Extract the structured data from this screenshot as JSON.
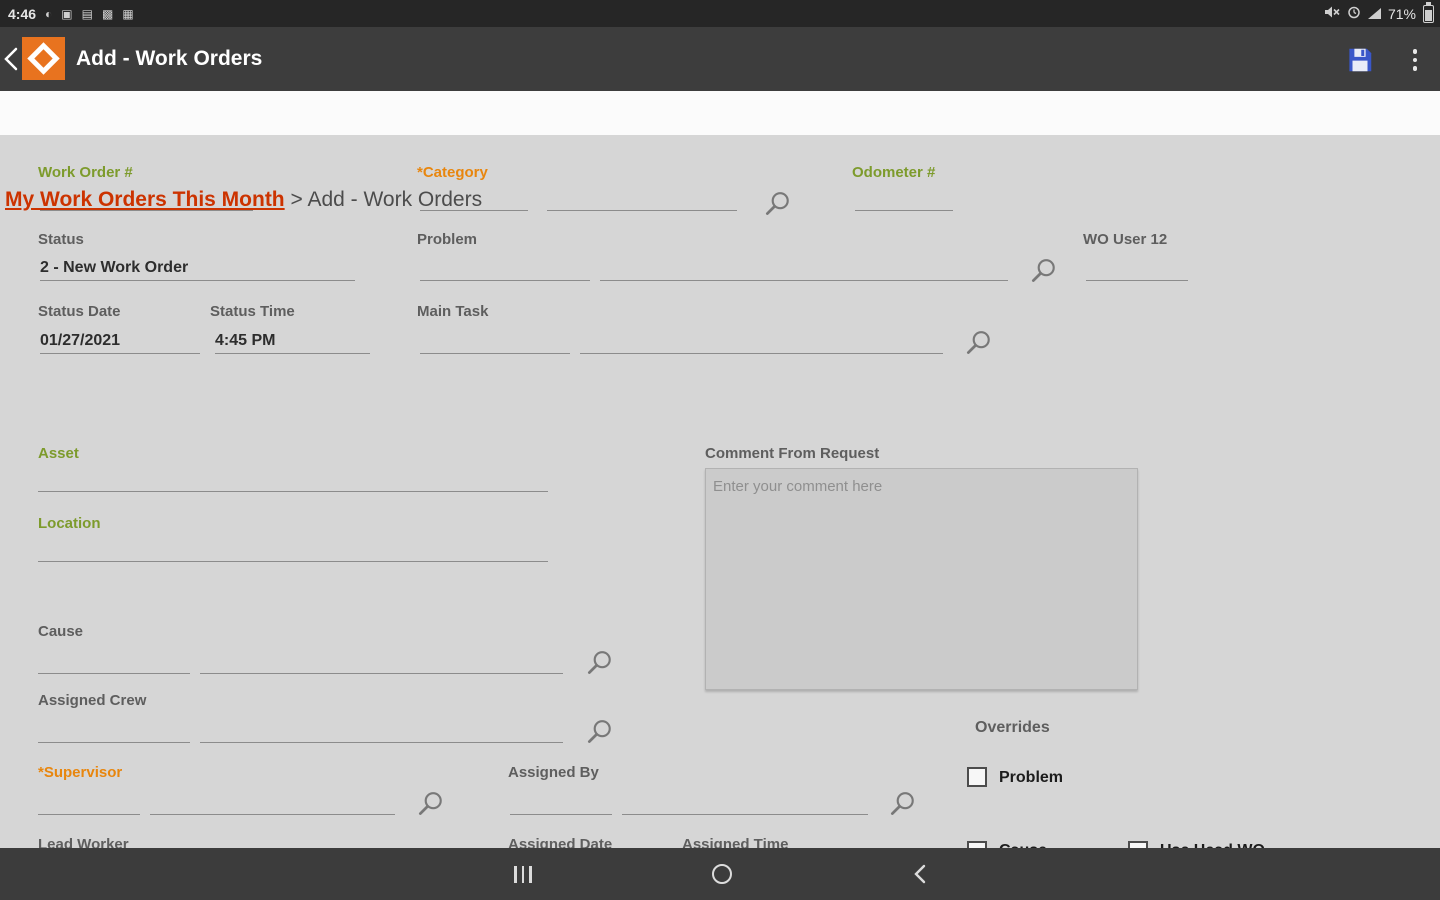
{
  "status_bar": {
    "time": "4:46",
    "battery_percent": "71%"
  },
  "app_bar": {
    "title": "Add - Work Orders"
  },
  "breadcrumb": {
    "link": "My Work Orders This Month",
    "separator": ">",
    "current": "Add - Work Orders"
  },
  "form": {
    "work_order_label": "Work Order #",
    "category_label": "*Category",
    "odometer_label": "Odometer #",
    "status_label": "Status",
    "status_value": "2 - New Work Order",
    "problem_label": "Problem",
    "wo_user_label": "WO User 12",
    "status_date_label": "Status Date",
    "status_date_value": "01/27/2021",
    "status_time_label": "Status Time",
    "status_time_value": "4:45 PM",
    "main_task_label": "Main Task",
    "asset_label": "Asset",
    "location_label": "Location",
    "comment_label": "Comment From Request",
    "comment_placeholder": "Enter your comment here",
    "cause_label": "Cause",
    "assigned_crew_label": "Assigned Crew",
    "supervisor_label": "*Supervisor",
    "lead_worker_label": "Lead Worker",
    "assigned_by_label": "Assigned By",
    "assigned_date_label": "Assigned Date",
    "assigned_time_label": "Assigned Time",
    "overrides_label": "Overrides",
    "override_problem_label": "Problem",
    "override_bottom_left_label": "Cause",
    "override_bottom_right_label": "Use Head WO"
  },
  "colors": {
    "accent_orange": "#e8731f",
    "label_green": "#7d9b2c",
    "label_orange": "#e8860e",
    "link_red": "#cc3300",
    "save_blue": "#3a57c9",
    "form_background": "#d6d6d6"
  }
}
